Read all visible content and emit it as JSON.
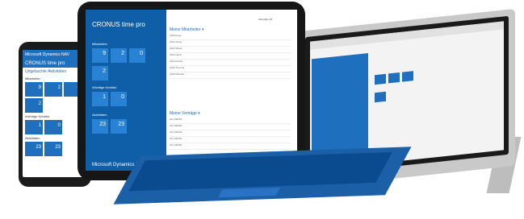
{
  "phone": {
    "app_title": "Microsoft Dynamics NAV",
    "title": "CRONUS time pro",
    "subtitle": "Ungebuchte Aktivitäten",
    "sections": [
      "Mitarbeiter",
      "Wichtige Kreditor",
      "Aktivitäten"
    ],
    "tiles": [
      "9",
      "2",
      "0",
      "2",
      "1",
      "0",
      "23",
      "23"
    ]
  },
  "ipad": {
    "title": "CRONUS time pro",
    "top_right": "Abmelden ⚙",
    "sections": [
      "Mitarbeiter",
      "Wichtige Kreditor",
      "Aktivitäten"
    ],
    "tiles": [
      "9",
      "2",
      "0",
      "2",
      "1",
      "0",
      "23",
      "23"
    ],
    "brand": "Microsoft Dynamics NAV",
    "right_lists": [
      {
        "title": "Meine Mitarbeiter ▾",
        "rows": [
          "1000 Kuge",
          "1001 Dinse",
          "1002 Weiss",
          "1003 Heidt",
          "1004 Dorlan",
          "1005 Thomas",
          "1006 Michael"
        ]
      },
      {
        "title": "Meine Verträge ▾",
        "rows": [
          "AU-100001",
          "AU-100002",
          "AU-100003",
          "AU-100004",
          "AU-100005"
        ]
      }
    ]
  },
  "colors": {
    "brand_blue": "#1f6fbf",
    "device_dark": "#161616"
  }
}
